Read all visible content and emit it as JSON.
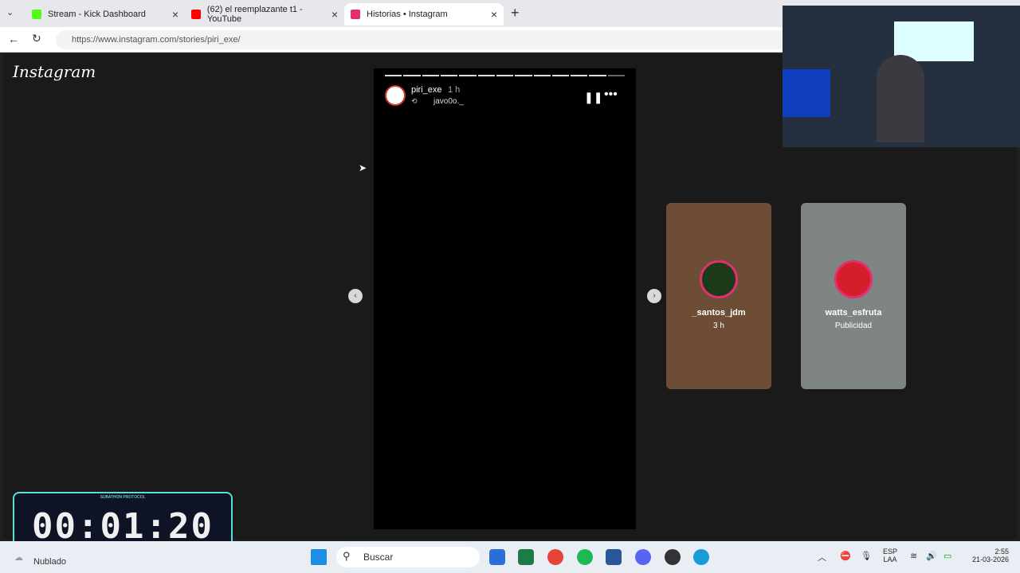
{
  "tabs": [
    {
      "title": "Stream - Kick Dashboard",
      "color": "#53fc18"
    },
    {
      "title": "(62) el reemplazante t1 - YouTube",
      "color": "#ff0000"
    },
    {
      "title": "Historias • Instagram",
      "color": "#e1306c"
    }
  ],
  "url": "https://www.instagram.com/stories/piri_exe/",
  "logo": "Instagram",
  "story": {
    "user": "piri_exe",
    "time": "1 h",
    "reposted_from": "javo0o._",
    "segments": 13
  },
  "thumbs": [
    {
      "name": "_santos_jdm",
      "sub": "3 h",
      "bg": "#6d4d36",
      "ava": "#1a3a1a"
    },
    {
      "name": "watts_esfruta",
      "sub": "Publicidad",
      "bg": "#7f8583",
      "ava": "#d41e2c"
    }
  ],
  "timer": {
    "label": "SUBATHON PROTOCOL",
    "value": "00:01:20"
  },
  "taskbar": {
    "weather": "Nublado",
    "search": "Buscar",
    "lang1": "ESP",
    "lang2": "LAA",
    "time": "2:55",
    "date": "21-03-2026"
  }
}
